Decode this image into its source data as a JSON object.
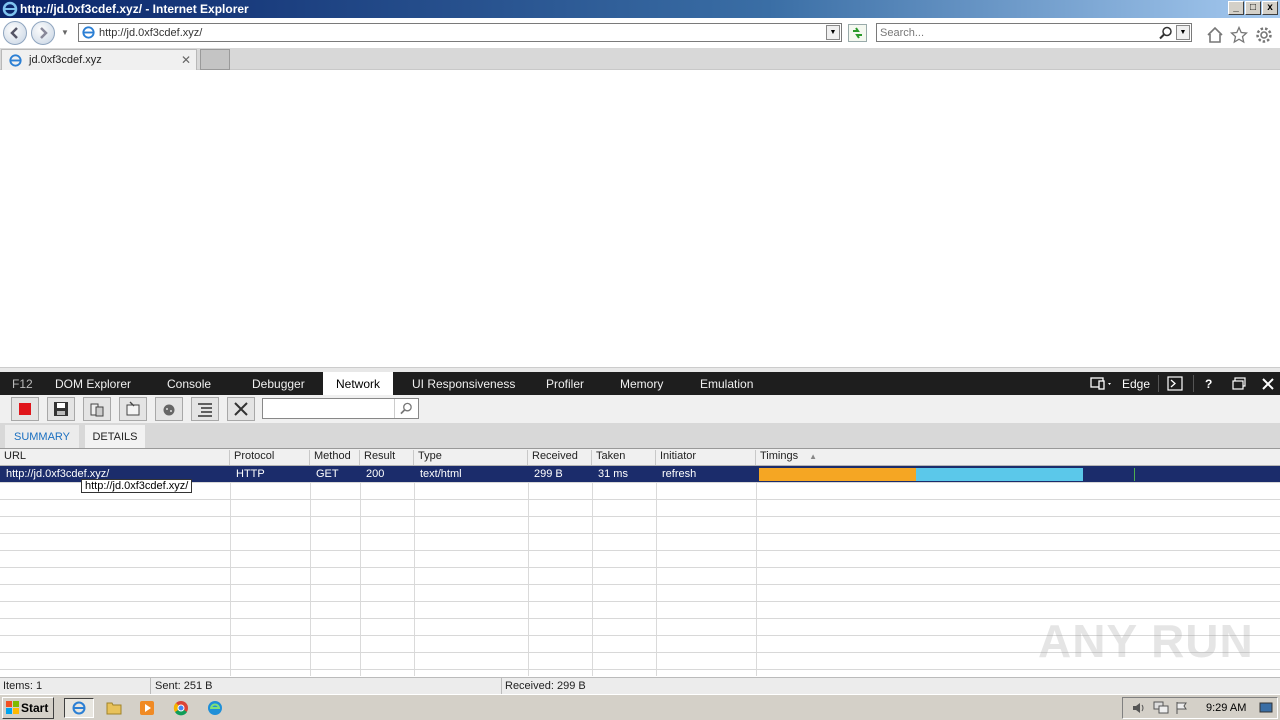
{
  "window": {
    "title": "http://jd.0xf3cdef.xyz/ - Internet Explorer",
    "buttons": [
      "_",
      "□",
      "x"
    ]
  },
  "navbar": {
    "address": "http://jd.0xf3cdef.xyz/",
    "search_placeholder": "Search..."
  },
  "tabs": [
    {
      "title": "jd.0xf3cdef.xyz"
    }
  ],
  "devtools": {
    "f12_label": "F12",
    "tabs": [
      "DOM Explorer",
      "Console",
      "Debugger",
      "Network",
      "UI Responsiveness",
      "Profiler",
      "Memory",
      "Emulation"
    ],
    "active_tab": "Network",
    "mode_label": "Edge",
    "help_label": "?",
    "subtabs": [
      "SUMMARY",
      "DETAILS"
    ],
    "active_subtab": "SUMMARY",
    "columns": [
      "URL",
      "Protocol",
      "Method",
      "Result",
      "Type",
      "Received",
      "Taken",
      "Initiator",
      "Timings"
    ],
    "rows": [
      {
        "url": "http://jd.0xf3cdef.xyz/",
        "protocol": "HTTP",
        "method": "GET",
        "result": "200",
        "type": "text/html",
        "received": "299 B",
        "taken": "31 ms",
        "initiator": "refresh"
      }
    ],
    "tooltip": "http://jd.0xf3cdef.xyz/",
    "status": {
      "items": "Items: 1",
      "sent": "Sent: 251 B",
      "received": "Received: 299 B"
    },
    "colors": {
      "waiting": "#f5a623",
      "receiving": "#5bc8ea",
      "selected_row": "#1b2c6b"
    }
  },
  "watermark": "ANY RUN",
  "taskbar": {
    "start_label": "Start",
    "clock": "9:29 AM"
  }
}
